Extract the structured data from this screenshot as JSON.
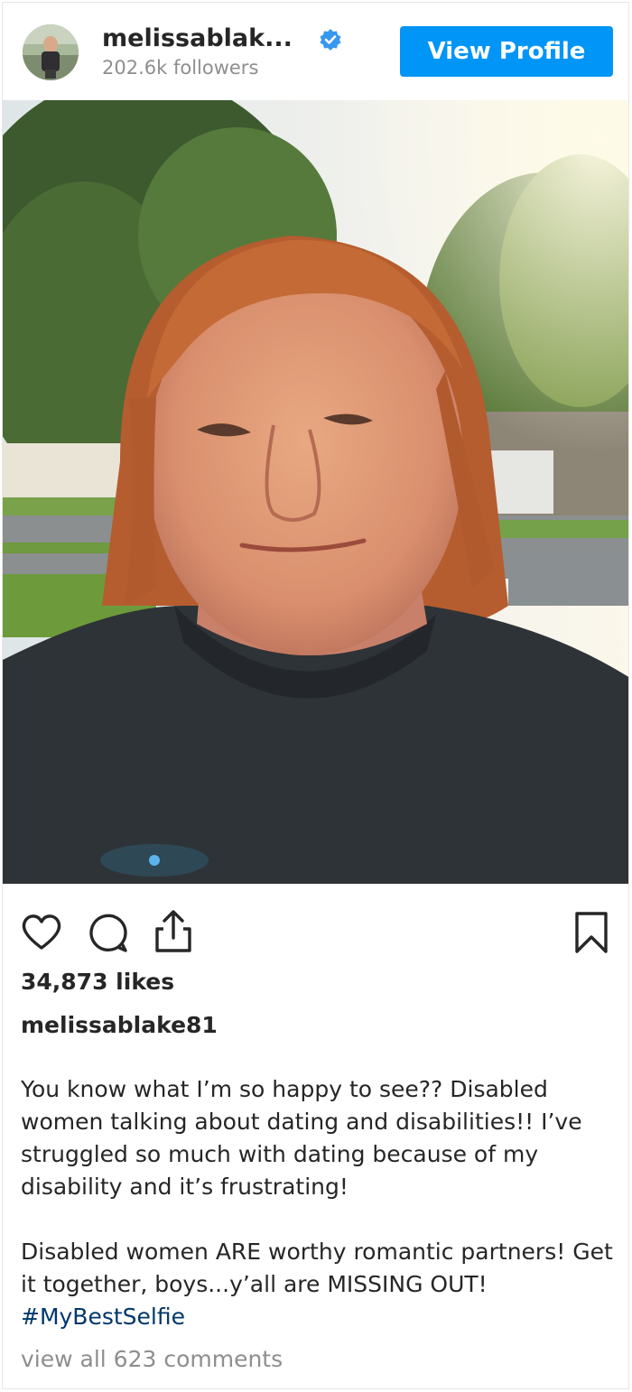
{
  "header": {
    "username": "melissablak...",
    "followers": "202.6k followers",
    "view_profile_label": "View Profile",
    "avatar_icon": "profile-avatar",
    "verified_icon": "verified-badge-icon"
  },
  "colors": {
    "accent": "#0095f6",
    "hashtag": "#00376b",
    "muted": "#8e8e8e",
    "text": "#262626"
  },
  "actions": {
    "icons": [
      "heart-icon",
      "comment-icon",
      "share-icon",
      "bookmark-icon"
    ]
  },
  "post": {
    "likes": "34,873 likes",
    "author": "melissablake81",
    "caption_line1": "You know what I’m so happy to see?? Disabled women talking about dating and disabilities!! I’ve struggled so much with dating because of my disability and it’s frustrating!",
    "caption_line2": "Disabled women ARE worthy romantic partners! Get it together, boys...y’all are MISSING OUT!",
    "hashtag": "#MyBestSelfie",
    "view_comments": "view all 623 comments"
  }
}
